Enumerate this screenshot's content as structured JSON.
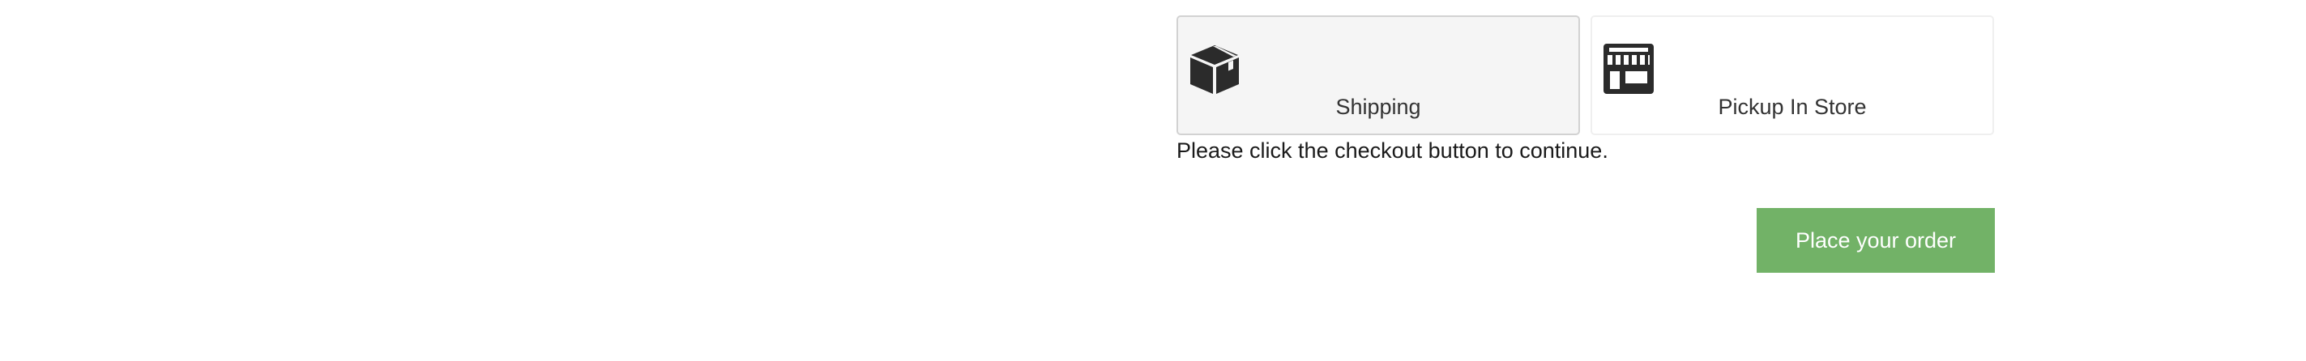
{
  "delivery_methods": [
    {
      "label": "Shipping",
      "icon": "box-icon",
      "selected": true
    },
    {
      "label": "Pickup In Store",
      "icon": "storefront-icon",
      "selected": false
    }
  ],
  "checkout_note": "Please click the checkout button to continue.",
  "place_order_label": "Place your order",
  "colors": {
    "accent": "#72b267",
    "icon": "#2b2b2b",
    "selected_bg": "#f5f5f5"
  }
}
